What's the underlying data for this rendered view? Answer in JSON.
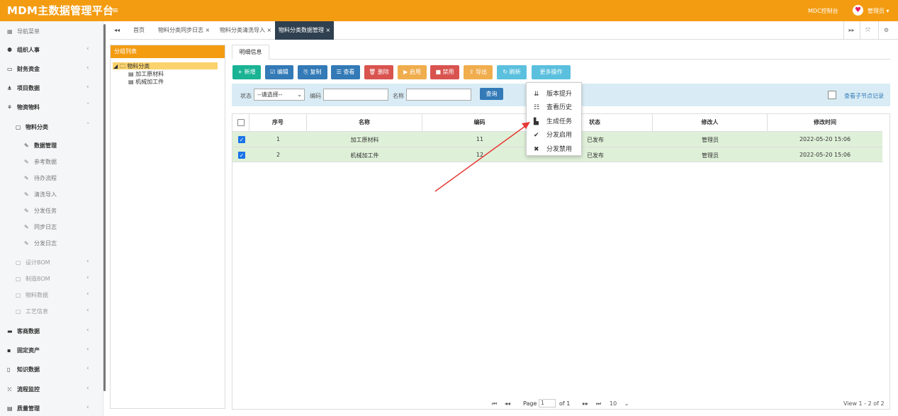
{
  "header": {
    "title": "MDM主数据管理平台",
    "menu_icon": "≡",
    "console_link": "MDC控制台",
    "user": "管理员 ▾",
    "user_icon": "location-pin-icon"
  },
  "sidebar": {
    "items": [
      {
        "icon": "▦",
        "label": "导航菜单"
      },
      {
        "icon": "⚉",
        "label": "组织人事",
        "chev": "‹"
      },
      {
        "icon": "▭",
        "label": "财务资金",
        "chev": "‹"
      },
      {
        "icon": "⋔",
        "label": "项目数据",
        "chev": "‹"
      },
      {
        "icon": "⚘",
        "label": "物资物料",
        "chev": "ˇ"
      },
      {
        "icon": "▢",
        "label": "物料分类",
        "chev": "ˇ"
      },
      {
        "icon": "✎",
        "label": "数据管理"
      },
      {
        "icon": "✎",
        "label": "参考数据"
      },
      {
        "icon": "✎",
        "label": "待办流程"
      },
      {
        "icon": "✎",
        "label": "清洗导入"
      },
      {
        "icon": "✎",
        "label": "分发任务"
      },
      {
        "icon": "✎",
        "label": "同步日志"
      },
      {
        "icon": "✎",
        "label": "分发日志"
      },
      {
        "icon": "▢",
        "label": "设计BOM",
        "chev": "‹"
      },
      {
        "icon": "▢",
        "label": "制造BOM",
        "chev": "‹"
      },
      {
        "icon": "▢",
        "label": "物料数据",
        "chev": "‹"
      },
      {
        "icon": "▢",
        "label": "工艺信息",
        "chev": "‹"
      },
      {
        "icon": "▬",
        "label": "客商数据",
        "chev": "‹"
      },
      {
        "icon": "▪",
        "label": "固定资产",
        "chev": "‹"
      },
      {
        "icon": "▯",
        "label": "知识数据",
        "chev": "‹"
      },
      {
        "icon": "⁙",
        "label": "流程监控",
        "chev": "‹"
      },
      {
        "icon": "▤",
        "label": "质量管理",
        "chev": "‹"
      }
    ]
  },
  "tabs": {
    "back": "◂◂",
    "home": "首页",
    "t1": "物料分类同步日志 ×",
    "t2": "物料分类清洗导入 ×",
    "t3": "物料分类数据管理 ×",
    "fwd": "▸▸",
    "full": "⤧",
    "gear": "⚙"
  },
  "left_panel": {
    "title": "分组列表",
    "root": "物料分类",
    "children": [
      "加工原材料",
      "机械加工件"
    ]
  },
  "right_panel": {
    "tab": "明细信息"
  },
  "toolbar": {
    "add": "+ 新增",
    "edit": "☑ 编辑",
    "copy": "⎘ 复制",
    "view": "☰ 查看",
    "del": "🗑 删除",
    "enable": "▶ 启用",
    "disable": "■ 禁用",
    "export": "⇪ 导出",
    "refresh": "↻ 刷新",
    "more": "更多操作"
  },
  "filter": {
    "status_label": "状态",
    "status_value": "--请选择--",
    "code_label": "编码",
    "name_label": "名称",
    "query": "查询",
    "child_label": "查看子节点记录"
  },
  "more_menu": [
    {
      "icon": "⇊",
      "label": "版本提升"
    },
    {
      "icon": "☷",
      "label": "查看历史"
    },
    {
      "icon": "▙",
      "label": "生成任务"
    },
    {
      "icon": "✔",
      "label": "分发启用"
    },
    {
      "icon": "✖",
      "label": "分发禁用"
    }
  ],
  "table": {
    "columns": [
      "序号",
      "名称",
      "编码",
      "状态",
      "修改人",
      "修改时间"
    ],
    "rows": [
      {
        "no": "1",
        "name": "加工原材料",
        "code": "11",
        "status": "已发布",
        "user": "管理员",
        "time": "2022-05-20 15:06"
      },
      {
        "no": "2",
        "name": "机械加工件",
        "code": "12",
        "status": "已发布",
        "user": "管理员",
        "time": "2022-05-20 15:06"
      }
    ]
  },
  "pager": {
    "first": "⏮",
    "prev": "◂◂",
    "page_label": "Page",
    "page": "1",
    "of": "of 1",
    "next": "▸▸",
    "last": "⏭",
    "size": "10",
    "summary": "View 1 - 2 of 2"
  },
  "colors": {
    "header": "#f39c12",
    "active_tab": "#2f4050",
    "row": "#dff0d8",
    "arrow": "#e53935"
  }
}
